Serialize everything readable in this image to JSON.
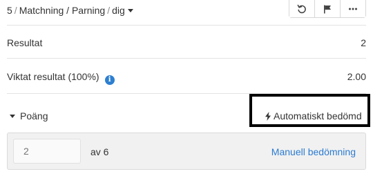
{
  "header": {
    "question_number": "5",
    "breadcrumb_type": "Matchning / Parning",
    "breadcrumb_owner": "dig",
    "toolbar": [
      "undo-icon",
      "flag-icon",
      "more-icon"
    ]
  },
  "results": {
    "result_label": "Resultat",
    "result_value": "2",
    "weighted_label": "Viktat resultat (100%)",
    "weighted_value": "2.00"
  },
  "points": {
    "toggle_label": "Poäng",
    "auto_graded_label": "Automatiskt bedömd",
    "score_placeholder": "2",
    "out_of_label": "av 6",
    "manual_grading_link": "Manuell bedömning"
  },
  "colors": {
    "accent": "#2b7bd0",
    "info": "#2d7fd0"
  }
}
